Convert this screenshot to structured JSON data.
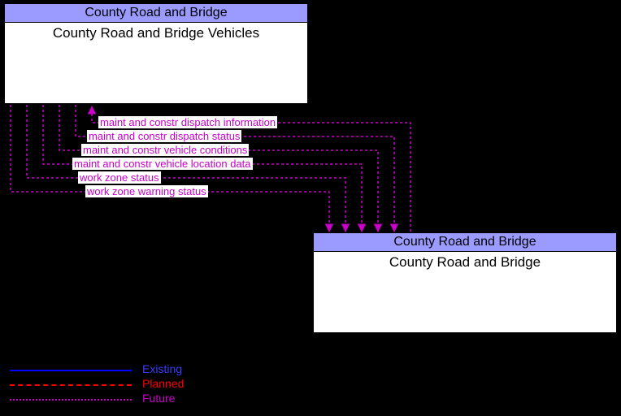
{
  "entity1": {
    "header": "County Road and Bridge",
    "title": "County Road and Bridge Vehicles"
  },
  "entity2": {
    "header": "County Road and Bridge",
    "title": "County Road and Bridge"
  },
  "flows": {
    "f1": "maint and constr dispatch information",
    "f2": "maint and constr dispatch status",
    "f3": "maint and constr vehicle conditions",
    "f4": "maint and constr vehicle location data",
    "f5": "work zone status",
    "f6": "work zone warning status"
  },
  "legend": {
    "existing": "Existing",
    "planned": "Planned",
    "future": "Future"
  },
  "chart_data": {
    "type": "node-link-diagram",
    "nodes": [
      {
        "id": "n1",
        "header": "County Road and Bridge",
        "title": "County Road and Bridge Vehicles"
      },
      {
        "id": "n2",
        "header": "County Road and Bridge",
        "title": "County Road and Bridge"
      }
    ],
    "links": [
      {
        "from": "n2",
        "to": "n1",
        "label": "maint and constr dispatch information",
        "status": "Future"
      },
      {
        "from": "n1",
        "to": "n2",
        "label": "maint and constr dispatch status",
        "status": "Future"
      },
      {
        "from": "n1",
        "to": "n2",
        "label": "maint and constr vehicle conditions",
        "status": "Future"
      },
      {
        "from": "n1",
        "to": "n2",
        "label": "maint and constr vehicle location data",
        "status": "Future"
      },
      {
        "from": "n1",
        "to": "n2",
        "label": "work zone status",
        "status": "Future"
      },
      {
        "from": "n1",
        "to": "n2",
        "label": "work zone warning status",
        "status": "Future"
      }
    ],
    "legend": [
      {
        "style": "solid",
        "color": "#0000ff",
        "label": "Existing"
      },
      {
        "style": "dash-dot",
        "color": "#ff0000",
        "label": "Planned"
      },
      {
        "style": "dotted",
        "color": "#c800c8",
        "label": "Future"
      }
    ]
  }
}
